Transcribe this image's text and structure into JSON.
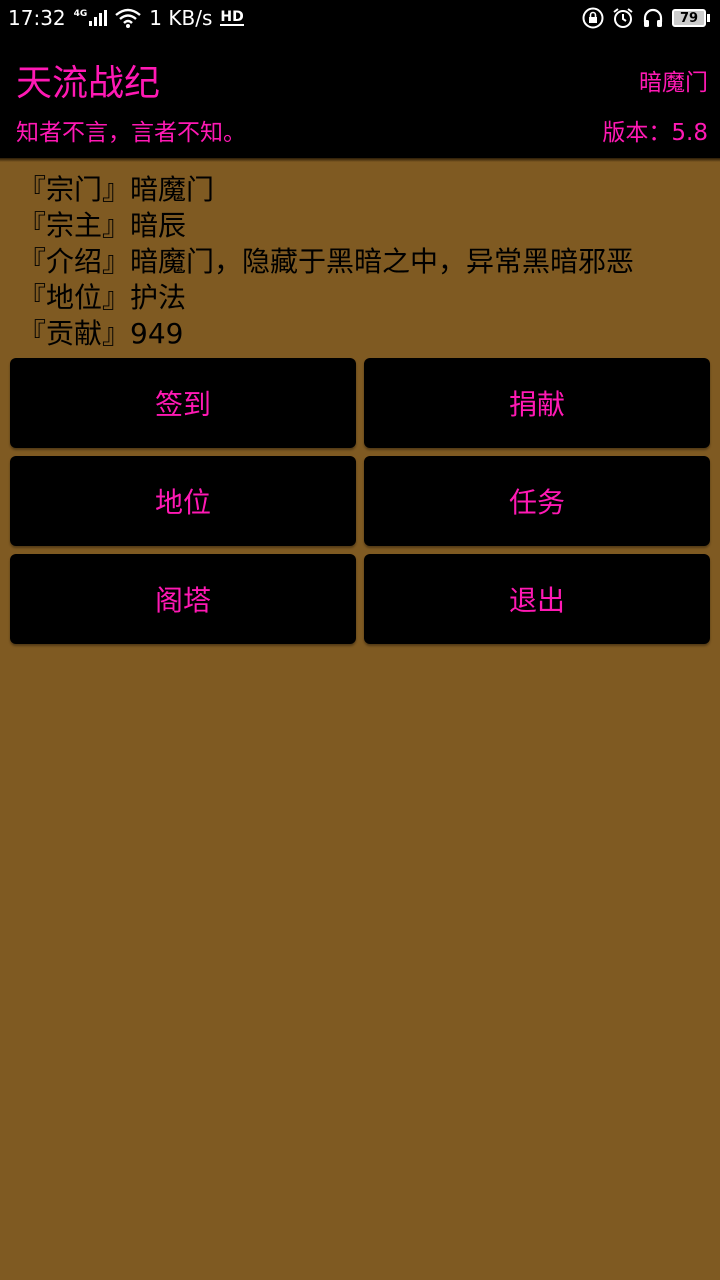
{
  "status_bar": {
    "time": "17:32",
    "network_type": "4G",
    "speed": "1 KB/s",
    "hd_label": "HD",
    "battery_level": "79",
    "icons": [
      "signal-icon",
      "wifi-icon",
      "lock-rotation-icon",
      "alarm-icon",
      "headphones-icon",
      "battery-icon"
    ]
  },
  "header": {
    "app_title": "天流战纪",
    "sect_name": "暗魔门",
    "motto": "知者不言，言者不知。",
    "version": "版本：5.8"
  },
  "info": {
    "sect": "『宗门』暗魔门",
    "leader": "『宗主』暗辰",
    "intro": "『介绍』暗魔门，隐藏于黑暗之中，异常黑暗邪恶",
    "rank": "『地位』护法",
    "contribution": "『贡献』949"
  },
  "buttons": {
    "checkin": "签到",
    "donate": "捐献",
    "rank": "地位",
    "task": "任务",
    "pavilion": "阁塔",
    "exit": "退出"
  },
  "colors": {
    "background": "#7f5a22",
    "bar": "#000000",
    "accent": "#ff19b4",
    "text": "#000000"
  }
}
